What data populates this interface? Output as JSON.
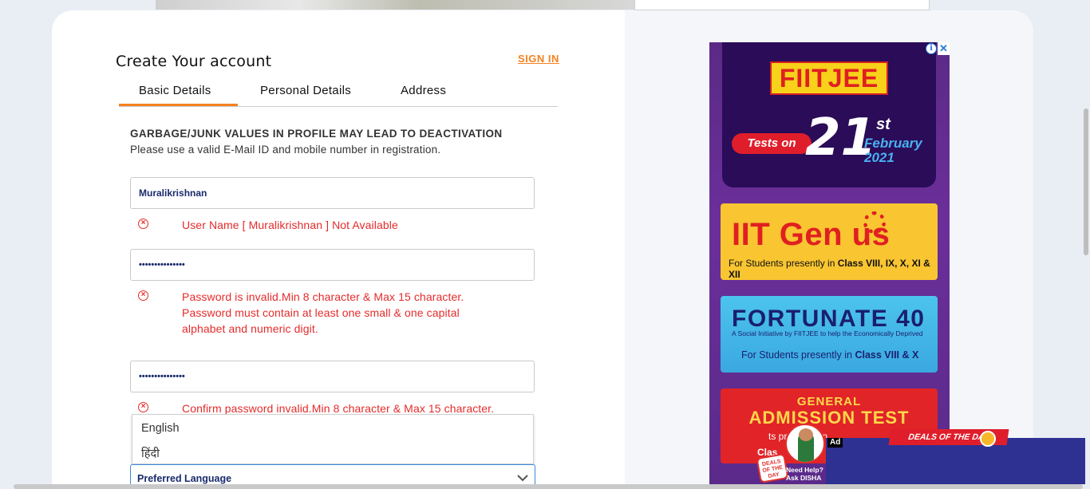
{
  "form": {
    "title": "Create Your account",
    "signin_label": "SIGN IN",
    "tabs": [
      {
        "label": "Basic Details",
        "active": true
      },
      {
        "label": "Personal Details",
        "active": false
      },
      {
        "label": "Address",
        "active": false
      }
    ],
    "warning_title": "GARBAGE/JUNK VALUES IN PROFILE MAY LEAD TO DEACTIVATION",
    "warning_subtitle": "Please use a valid E-Mail ID and mobile number in registration.",
    "username_value": "Muralikrishnan",
    "username_error": "User Name [ Muralikrishnan ] Not Available",
    "password_value": "•••••••••••••••",
    "password_error_lines": [
      "Password is invalid.Min 8 character & Max 15 character.",
      "Password must contain at least one small & one capital",
      "alphabet and numeric digit."
    ],
    "confirm_value": "•••••••••••••••",
    "confirm_error": "Confirm password invalid.Min 8 character & Max 15 character.",
    "language_options": [
      "English",
      "हिंदी"
    ],
    "language_select_value": "Preferred Language"
  },
  "ad": {
    "brand": "FIITJEE",
    "tests_on": "Tests on",
    "date_day": "21",
    "date_suffix": "st",
    "date_month": "February",
    "date_year": "2021",
    "iit_genius": "IIT Gen  us",
    "iit_genius_sub_prefix": "For Students presently in ",
    "iit_genius_sub_classes": "Class VIII, IX, X, XI & XII",
    "fortunate": "FORTUNATE 40",
    "fortunate_tag": "A Social Initiative by FIITJEE to help the Economically Deprived",
    "fortunate_sub_prefix": "For Students presently in ",
    "fortunate_sub_classes": "Class VIII & X",
    "general": "GENERAL",
    "admission": "ADMISSION TEST",
    "gat_sub": "ts presently in",
    "gat_sub2": "Clas"
  },
  "sticky_ad": {
    "ad_label": "Ad",
    "deals": "DEALS OF THE DAY",
    "need_help": "Need Help?",
    "ask_disha": "Ask DISHA",
    "deals_tag": "DEALS OF THE DAY"
  },
  "colors": {
    "accent": "#f58220",
    "error": "#e52b2b",
    "field_text": "#1a2a6c",
    "ad_bg": "#5b2a86"
  }
}
